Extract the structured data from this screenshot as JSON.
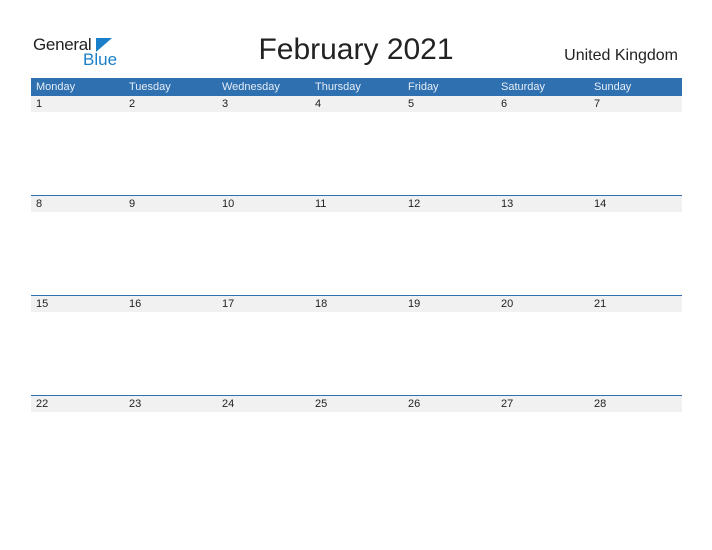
{
  "logo": {
    "text_top": "General",
    "text_bottom": "Blue"
  },
  "header": {
    "title": "February 2021",
    "country": "United Kingdom"
  },
  "calendar": {
    "weekdays": [
      "Monday",
      "Tuesday",
      "Wednesday",
      "Thursday",
      "Friday",
      "Saturday",
      "Sunday"
    ],
    "weeks": [
      [
        "1",
        "2",
        "3",
        "4",
        "5",
        "6",
        "7"
      ],
      [
        "8",
        "9",
        "10",
        "11",
        "12",
        "13",
        "14"
      ],
      [
        "15",
        "16",
        "17",
        "18",
        "19",
        "20",
        "21"
      ],
      [
        "22",
        "23",
        "24",
        "25",
        "26",
        "27",
        "28"
      ]
    ]
  },
  "colors": {
    "accent": "#2e70b0",
    "logo_blue": "#1a7fc9",
    "day_strip": "#f1f1f1"
  }
}
